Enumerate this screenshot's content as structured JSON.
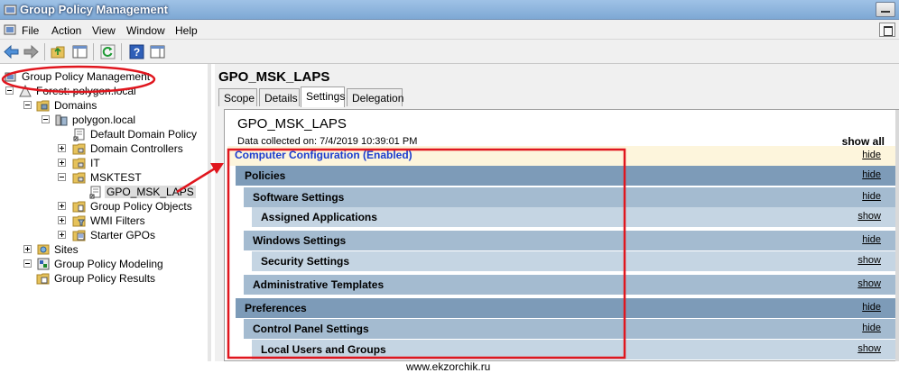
{
  "window": {
    "title": "Group Policy Management"
  },
  "menu": {
    "items": [
      "File",
      "Action",
      "View",
      "Window",
      "Help"
    ]
  },
  "tree": {
    "items": [
      {
        "label": "Group Policy Management",
        "icon": "gpm-console-icon"
      },
      {
        "label": "Forest: polygon.local",
        "icon": "forest-icon"
      },
      {
        "label": "Domains",
        "icon": "domains-folder-icon"
      },
      {
        "label": "polygon.local",
        "icon": "domain-icon"
      },
      {
        "label": "Default Domain Policy",
        "icon": "gpo-link-icon"
      },
      {
        "label": "Domain Controllers",
        "icon": "ou-folder-icon"
      },
      {
        "label": "IT",
        "icon": "ou-folder-icon"
      },
      {
        "label": "MSKTEST",
        "icon": "ou-folder-icon"
      },
      {
        "label": "GPO_MSK_LAPS",
        "icon": "gpo-link-icon"
      },
      {
        "label": "Group Policy Objects",
        "icon": "gpo-folder-icon"
      },
      {
        "label": "WMI Filters",
        "icon": "wmi-folder-icon"
      },
      {
        "label": "Starter GPOs",
        "icon": "starter-folder-icon"
      },
      {
        "label": "Sites",
        "icon": "sites-icon"
      },
      {
        "label": "Group Policy Modeling",
        "icon": "modeling-icon"
      },
      {
        "label": "Group Policy Results",
        "icon": "results-icon"
      }
    ]
  },
  "details": {
    "header": "GPO_MSK_LAPS",
    "tabs": [
      "Scope",
      "Details",
      "Settings",
      "Delegation"
    ],
    "active_tab": "Settings",
    "report_title": "GPO_MSK_LAPS",
    "collected": "Data collected on: 7/4/2019 10:39:01 PM",
    "show_all": "show all",
    "sections": {
      "computer_configuration": {
        "label": "Computer Configuration (Enabled)",
        "link": "hide"
      },
      "policies": {
        "label": "Policies",
        "link": "hide"
      },
      "software_settings": {
        "label": "Software Settings",
        "link": "hide"
      },
      "assigned_applications": {
        "label": "Assigned Applications",
        "link": "show"
      },
      "windows_settings": {
        "label": "Windows Settings",
        "link": "hide"
      },
      "security_settings": {
        "label": "Security Settings",
        "link": "show"
      },
      "administrative_templates": {
        "label": "Administrative Templates",
        "link": "show"
      },
      "preferences": {
        "label": "Preferences",
        "link": "hide"
      },
      "control_panel_settings": {
        "label": "Control Panel Settings",
        "link": "hide"
      },
      "local_users_and_groups": {
        "label": "Local Users and Groups",
        "link": "show"
      }
    }
  },
  "colors": {
    "annotation": "#e0161e",
    "section_dark": "#7d9bb8",
    "section_mid": "#a4bbd0",
    "section_light": "#c5d5e3",
    "computer_config_bg": "#fdf5dc",
    "computer_config_text": "#1a3ccf"
  },
  "watermark": "www.ekzorchik.ru"
}
